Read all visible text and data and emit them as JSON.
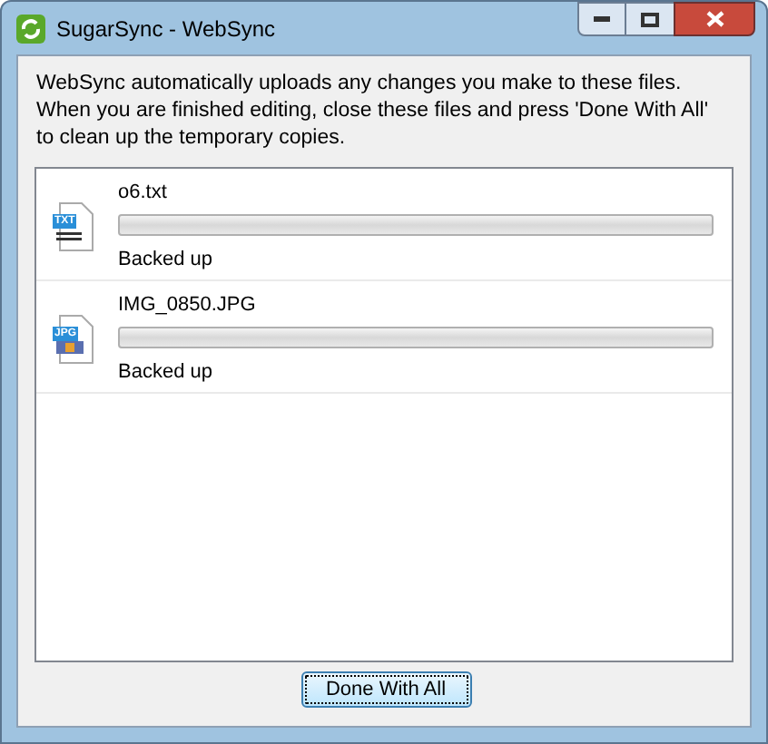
{
  "window": {
    "title": "SugarSync - WebSync"
  },
  "message": "WebSync automatically uploads any changes you make to these files. When you are finished editing, close these files and press 'Done With All' to clean up the temporary copies.",
  "files": [
    {
      "name": "o6.txt",
      "icon_text": "TXT",
      "kind": "text",
      "level": 0,
      "status": "Backed up"
    },
    {
      "name": "IMG_0850.JPG",
      "icon_text": "JPG",
      "kind": "image",
      "level": 0,
      "status": "Backed up"
    }
  ],
  "buttons": [
    "Done With All"
  ]
}
